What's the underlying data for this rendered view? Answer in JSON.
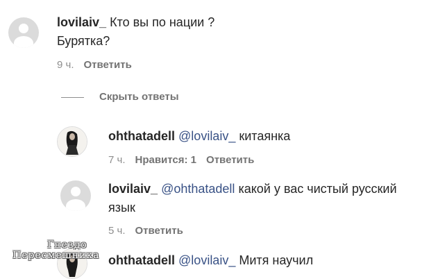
{
  "comments": [
    {
      "username": "lovilaiv_",
      "text": "Кто вы по нации ?",
      "text2": "Бурятка?",
      "time": "9 ч.",
      "reply_label": "Ответить"
    }
  ],
  "replies_toggle": "Скрыть ответы",
  "replies": [
    {
      "username": "ohthatadell",
      "mention": "@lovilaiv_",
      "text": "китаянка",
      "time": "7 ч.",
      "likes_label": "Нравится: 1",
      "reply_label": "Ответить"
    },
    {
      "username": "lovilaiv_",
      "mention": "@ohthatadell",
      "text": "какой у вас чистый русский",
      "text2": "язык",
      "time": "5 ч.",
      "reply_label": "Ответить"
    },
    {
      "username": "ohthatadell",
      "mention": "@lovilaiv_",
      "text": "Митя научил"
    }
  ],
  "watermark": {
    "line1": "Гнездо",
    "line2": "Пересмешника"
  },
  "colors": {
    "mention": "#385185",
    "meta": "#8e8e8e",
    "avatar_bg": "#dbdbdb"
  }
}
